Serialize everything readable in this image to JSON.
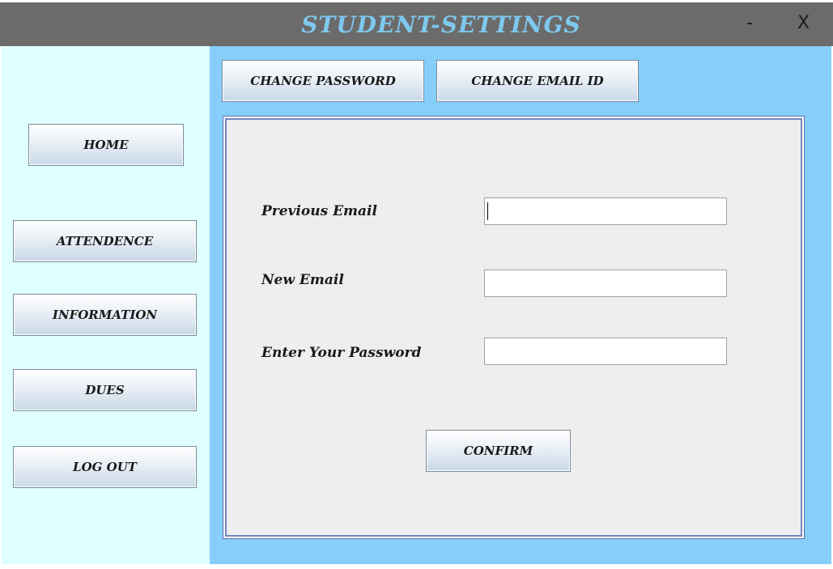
{
  "window": {
    "title": "STUDENT-SETTINGS",
    "minimize_label": "-",
    "close_label": "X"
  },
  "sidebar": {
    "items": [
      {
        "label": "HOME"
      },
      {
        "label": "ATTENDENCE"
      },
      {
        "label": "INFORMATION"
      },
      {
        "label": "DUES"
      },
      {
        "label": "LOG OUT"
      }
    ]
  },
  "tabs": [
    {
      "label": "CHANGE PASSWORD"
    },
    {
      "label": "CHANGE EMAIL ID"
    }
  ],
  "form": {
    "previous_email_label": "Previous Email",
    "previous_email_value": "",
    "new_email_label": "New Email",
    "new_email_value": "",
    "password_label": "Enter Your Password",
    "password_value": "",
    "confirm_label": "CONFIRM"
  },
  "colors": {
    "titlebar": "#6b6b6b",
    "title_text": "#7ec8ee",
    "sidebar_bg": "#e0ffff",
    "main_bg": "#87cefa",
    "panel_bg": "#eeeeee",
    "panel_border": "#6f86c0"
  }
}
